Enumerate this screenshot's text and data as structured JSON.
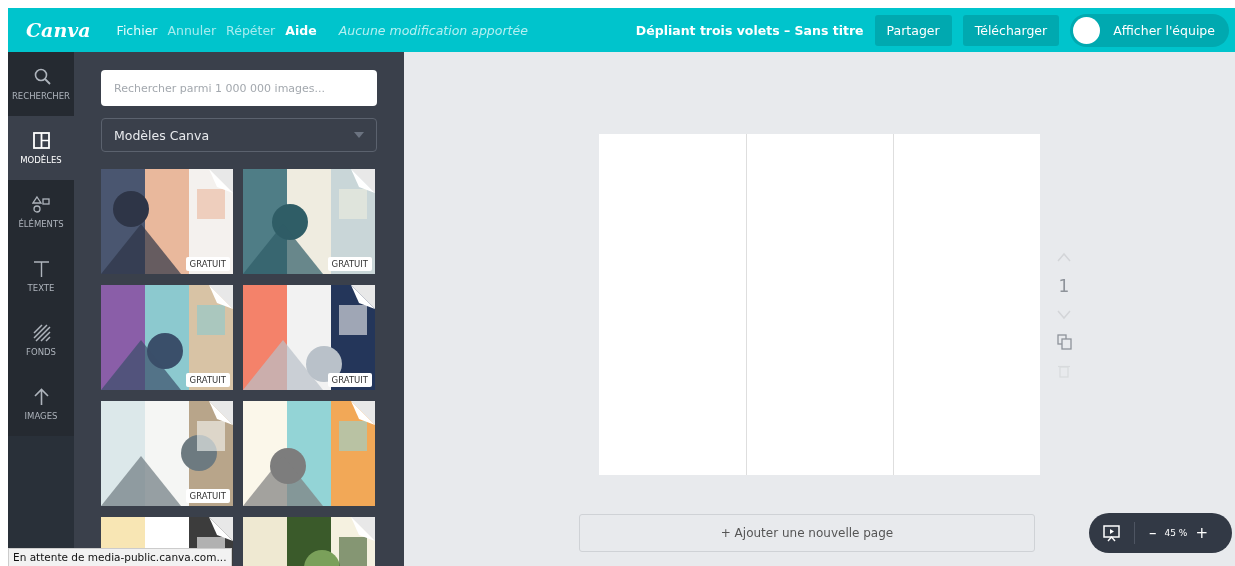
{
  "topbar": {
    "logo": "Canva",
    "menu": [
      {
        "label": "Fichier",
        "disabled": false
      },
      {
        "label": "Annuler",
        "disabled": true
      },
      {
        "label": "Répéter",
        "disabled": true
      },
      {
        "label": "Aide",
        "disabled": false
      }
    ],
    "save_status": "Aucune modification apportée",
    "document_title": "Dépliant trois volets – Sans titre",
    "buttons": [
      "Partager",
      "Télécharger"
    ],
    "team_toggle": {
      "label": "Afficher l'équipe",
      "on": false
    }
  },
  "sidebar": {
    "items": [
      {
        "label": "RECHERCHER",
        "selected": false
      },
      {
        "label": "MODÈLES",
        "selected": true
      },
      {
        "label": "ÉLÉMENTS",
        "selected": false
      },
      {
        "label": "TEXTE",
        "selected": false
      },
      {
        "label": "FONDS",
        "selected": false
      },
      {
        "label": "IMAGES",
        "selected": false
      }
    ]
  },
  "panel": {
    "search": {
      "placeholder": "Rechercher parmi 1 000 000 images..."
    },
    "dropdown": {
      "value": "Modèles Canva"
    },
    "templates": [
      {
        "kind": "picture",
        "badge": "GRATUIT"
      },
      {
        "kind": "picture",
        "badge": "GRATUIT"
      },
      {
        "kind": "picture",
        "badge": "GRATUIT"
      },
      {
        "kind": "picture",
        "badge": "GRATUIT"
      },
      {
        "kind": "picture",
        "badge": "GRATUIT"
      },
      {
        "kind": "picture"
      },
      {
        "kind": "picture"
      },
      {
        "kind": "picture"
      }
    ]
  },
  "canvas": {
    "page_number": "1",
    "add_page": "+ Ajouter une nouvelle page"
  },
  "zoom": {
    "value": "45 %",
    "minus": "–",
    "plus": "+"
  },
  "status_bar": "En attente de media-public.canva.com..."
}
